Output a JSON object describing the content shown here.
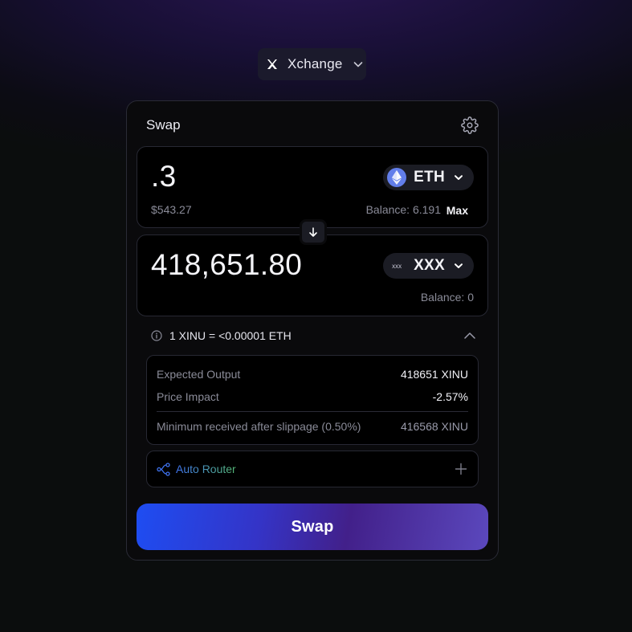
{
  "network_selector": {
    "label": "Xchange",
    "icon": "xchange-logo-icon"
  },
  "card": {
    "title": "Swap",
    "settings_icon": "gear-icon"
  },
  "from": {
    "amount": ".3",
    "usd_value": "$543.27",
    "token": "ETH",
    "token_icon": "ethereum-icon",
    "balance": "Balance: 6.191",
    "max_label": "Max"
  },
  "switch_icon": "arrow-down-icon",
  "to": {
    "amount": "418,651.80",
    "token": "XXX",
    "token_icon_text": "xxx",
    "balance": "Balance: 0"
  },
  "rate": {
    "text": "1 XINU = <0.00001 ETH",
    "icon": "info-icon",
    "toggle_icon": "chevron-up-icon"
  },
  "details": {
    "expected_output_label": "Expected Output",
    "expected_output_value": "418651 XINU",
    "price_impact_label": "Price Impact",
    "price_impact_value": "-2.57%",
    "min_received_label": "Minimum received after slippage (0.50%)",
    "min_received_value": "416568 XINU"
  },
  "router": {
    "label": "Auto Router",
    "icon": "route-icon",
    "expand_icon": "plus-icon"
  },
  "swap_button": {
    "label": "Swap"
  },
  "colors": {
    "accent_start": "#1e4df2",
    "accent_end": "#5b48bd",
    "router_gradient_start": "#3f73f0",
    "router_gradient_end": "#55b874",
    "ethereum_badge": "#627eea"
  }
}
